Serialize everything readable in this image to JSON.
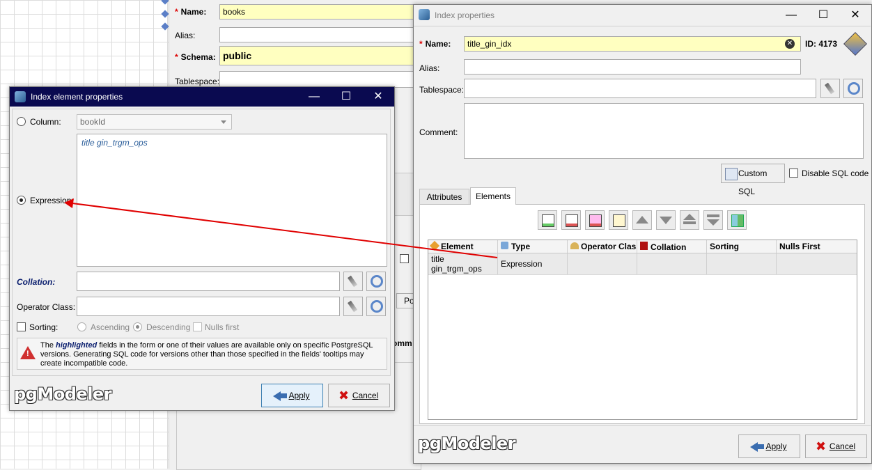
{
  "background_form": {
    "name_label": "Name:",
    "name_value": "books",
    "alias_label": "Alias:",
    "schema_label": "Schema:",
    "schema_value": "public",
    "tablespace_label": "Tablespace:",
    "partial_button_text": "Po",
    "partial_tab_text": "omm"
  },
  "index_properties": {
    "title": "Index properties",
    "name_label": "Name:",
    "name_value": "title_gin_idx",
    "id_text": "ID: 4173",
    "alias_label": "Alias:",
    "tablespace_label": "Tablespace:",
    "comment_label": "Comment:",
    "custom_sql_label": "Custom SQL",
    "disable_sql_label": "Disable SQL code",
    "tabs": [
      "Attributes",
      "Elements"
    ],
    "table": {
      "columns": [
        "Element",
        "Type",
        "Operator Class",
        "Collation",
        "Sorting",
        "Nulls First"
      ],
      "rows": [
        {
          "element": "title\ngin_trgm_ops",
          "type": "Expression",
          "operator_class": "",
          "collation": "",
          "sorting": "",
          "nulls_first": ""
        }
      ]
    },
    "apply_label": "Apply",
    "cancel_label": "Cancel",
    "brand": "pgModeler"
  },
  "element_properties": {
    "title": "Index element properties",
    "column_label": "Column:",
    "column_value": "bookId",
    "expression_label": "Expression:",
    "expression_text": "title gin_trgm_ops",
    "collation_label": "Collation:",
    "operator_class_label": "Operator Class:",
    "sorting_label": "Sorting:",
    "ascending_label": "Ascending",
    "descending_label": "Descending",
    "nulls_first_label": "Nulls first",
    "warning_pre": "The ",
    "warning_highlight": "highlighted",
    "warning_post": " fields in the form or one of their values are available only on specific PostgreSQL versions. Generating SQL code for versions other than those specified in the fields' tooltips may create incompatible code.",
    "apply_label": "Apply",
    "cancel_label": "Cancel",
    "brand": "pgModeler"
  },
  "colors": {
    "highlight_field": "#ffffc0",
    "element_title_bar": "#0a0a50",
    "annotation_arrow": "#e00000",
    "expression_text": "#2a5d9a"
  }
}
